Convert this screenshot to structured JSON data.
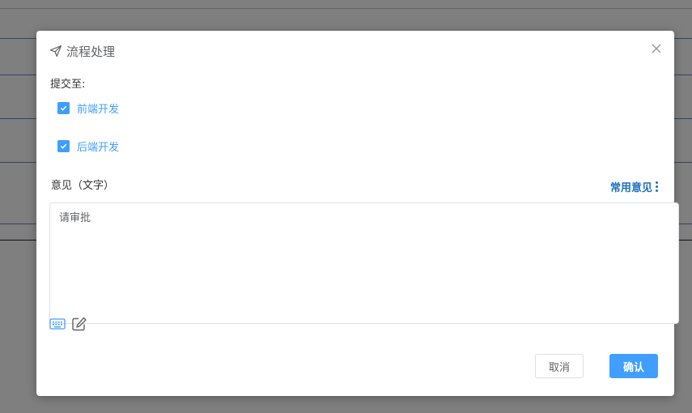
{
  "dialog": {
    "title": "流程处理",
    "submit_to_label": "提交至:",
    "recipients": [
      {
        "label": "前端开发",
        "checked": true
      },
      {
        "label": "后端开发",
        "checked": true
      }
    ],
    "opinion_label": "意见（文字）",
    "common_opinion_label": "常用意见",
    "opinion_value": "请审批",
    "cancel_label": "取消",
    "confirm_label": "确认"
  },
  "colors": {
    "accent": "#409eff",
    "link": "#1f6fbf",
    "overlay": "rgba(0,0,0,0.5)"
  },
  "icons": [
    "send-icon",
    "close-icon",
    "check-icon",
    "more-vertical-icon",
    "keyboard-icon",
    "edit-icon"
  ]
}
